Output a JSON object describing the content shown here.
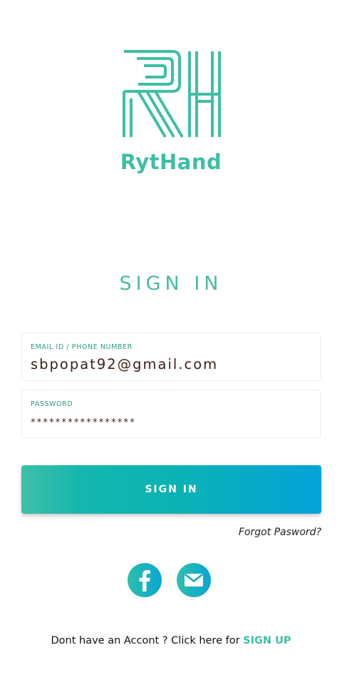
{
  "app": {
    "brand_name": "RytHand",
    "brand_color": "#3dbfa4"
  },
  "signin": {
    "title": "SIGN IN",
    "email_label": "EMAIL ID / PHONE NUMBER",
    "email_value": "sbpopat92@gmail.com",
    "password_label": "PASSWORD",
    "password_value": "*****************",
    "button_label": "SIGN IN",
    "forgot_label": "Forgot Pasword?"
  },
  "social": {
    "icons": [
      "facebook-icon",
      "mail-icon"
    ]
  },
  "footer": {
    "prompt": "Dont have an Accont ? Click here for ",
    "signup_label": "SIGN UP"
  }
}
